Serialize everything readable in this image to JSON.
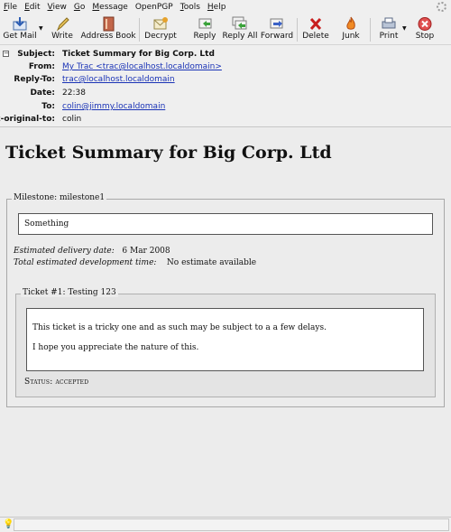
{
  "menubar": {
    "items": [
      {
        "label": "File",
        "access": "F",
        "rest": "ile"
      },
      {
        "label": "Edit",
        "access": "E",
        "rest": "dit"
      },
      {
        "label": "View",
        "access": "V",
        "rest": "iew"
      },
      {
        "label": "Go",
        "access": "G",
        "rest": "o"
      },
      {
        "label": "Message",
        "access": "M",
        "rest": "essage"
      },
      {
        "label": "OpenPGP",
        "access": "",
        "rest": "OpenPGP"
      },
      {
        "label": "Tools",
        "access": "T",
        "rest": "ools"
      },
      {
        "label": "Help",
        "access": "H",
        "rest": "elp"
      }
    ]
  },
  "toolbar": {
    "get_mail": "Get Mail",
    "write": "Write",
    "address_book": "Address Book",
    "decrypt": "Decrypt",
    "reply": "Reply",
    "reply_all": "Reply All",
    "forward": "Forward",
    "delete": "Delete",
    "junk": "Junk",
    "print": "Print",
    "stop": "Stop",
    "icons": {
      "get_mail": "get-mail-icon",
      "write": "pencil-icon",
      "address_book": "address-book-icon",
      "decrypt": "decrypt-icon",
      "reply": "reply-icon",
      "reply_all": "reply-all-icon",
      "forward": "forward-icon",
      "delete": "delete-x-icon",
      "junk": "junk-flame-icon",
      "print": "printer-icon",
      "stop": "stop-icon"
    }
  },
  "headers": {
    "subject_label": "Subject:",
    "subject": "Ticket Summary for Big Corp. Ltd",
    "from_label": "From:",
    "from": "My Trac <trac@localhost.localdomain>",
    "reply_to_label": "Reply-To:",
    "reply_to": "trac@localhost.localdomain",
    "date_label": "Date:",
    "date": "22:38",
    "to_label": "To:",
    "to": "colin@jimmy.localdomain",
    "x_original_to_label": "x-original-to:",
    "x_original_to": "colin"
  },
  "message": {
    "title": "Ticket Summary for Big Corp. Ltd",
    "milestone_legend": "Milestone: milestone1",
    "milestone_description": "Something",
    "delivery_label": "Estimated delivery date:",
    "delivery_value": "6 Mar 2008",
    "dev_time_label": "Total estimated development time:",
    "dev_time_value": "No estimate available",
    "ticket_legend": "Ticket #1: Testing 123",
    "ticket_para1": "This ticket is a tricky one and as such may be subject to a a few delays.",
    "ticket_para2": "I hope you appreciate the nature of this.",
    "status": "Status: accepted"
  },
  "colors": {
    "link": "#1a33b6",
    "chrome": "#efefef",
    "body_bg": "#ececec"
  }
}
